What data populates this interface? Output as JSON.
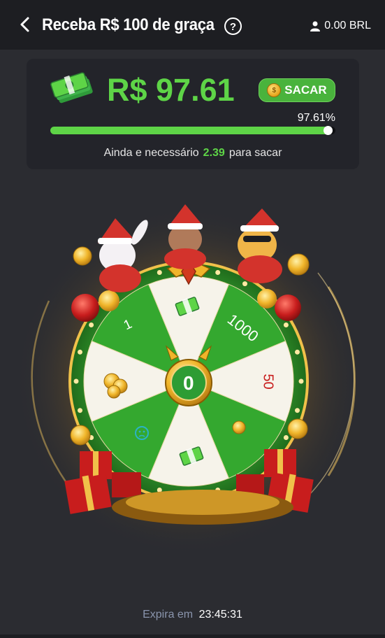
{
  "header": {
    "title": "Receba R$ 100 de graça",
    "balance": "0.00 BRL",
    "icons": {
      "back": "chevron-left-icon",
      "help": "question-circle-icon",
      "user": "user-icon"
    }
  },
  "reward_card": {
    "amount": "R$ 97.61",
    "withdraw_label": "SACAR",
    "progress_label": "97.61%",
    "progress_value": 0.9761,
    "needed_prefix": "Ainda e necessário",
    "needed_value": "2.39",
    "needed_suffix": "para sacar"
  },
  "wheel": {
    "segments": [
      "1",
      "1000",
      "50"
    ],
    "center_label": "0"
  },
  "footer": {
    "expires_label": "Expira em",
    "time": "23:45:31"
  },
  "colors": {
    "accent_green": "#5ed447",
    "button_green": "#49b33c",
    "background": "#2b2c31",
    "header_bg": "#1d1e22",
    "card_bg": "#23242a",
    "gold": "#e7b32a"
  }
}
